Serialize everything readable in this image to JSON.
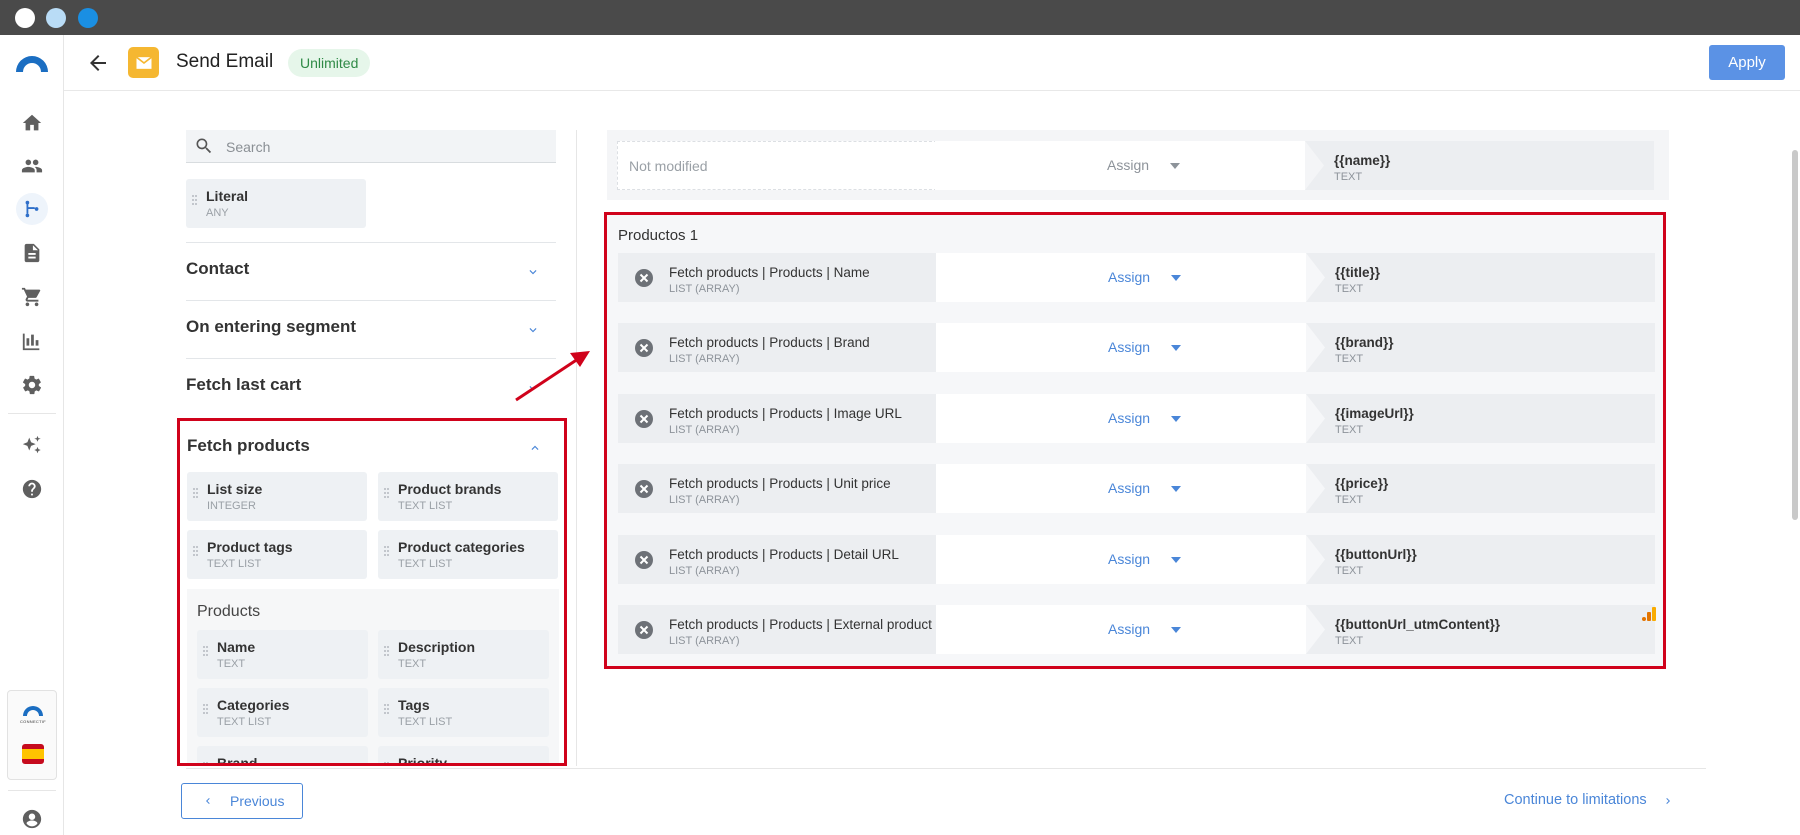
{
  "header": {
    "title": "Send Email",
    "plan_badge": "Unlimited",
    "apply_label": "Apply"
  },
  "rail": {
    "items": [
      "home-icon",
      "contacts-icon",
      "flows-icon",
      "document-icon",
      "cart-icon",
      "reports-icon",
      "settings-icon",
      "ai-sparkle-icon",
      "help-icon"
    ],
    "active": "flows-icon",
    "brand_text": "CONNECTIF",
    "language": "es"
  },
  "left_panel": {
    "search_placeholder": "Search",
    "literal": {
      "label": "Literal",
      "type": "ANY"
    },
    "sections": [
      {
        "title": "Contact",
        "expanded": false
      },
      {
        "title": "On entering segment",
        "expanded": false
      },
      {
        "title": "Fetch last cart",
        "expanded": false
      },
      {
        "title": "Fetch products",
        "expanded": true
      }
    ],
    "fetch_products_fields": [
      {
        "label": "List size",
        "type": "INTEGER"
      },
      {
        "label": "Product brands",
        "type": "TEXT LIST"
      },
      {
        "label": "Product tags",
        "type": "TEXT LIST"
      },
      {
        "label": "Product categories",
        "type": "TEXT LIST"
      }
    ],
    "products_group": {
      "title": "Products",
      "fields": [
        {
          "label": "Name",
          "type": "TEXT"
        },
        {
          "label": "Description",
          "type": "TEXT"
        },
        {
          "label": "Categories",
          "type": "TEXT LIST"
        },
        {
          "label": "Tags",
          "type": "TEXT LIST"
        },
        {
          "label": "Brand",
          "type": ""
        },
        {
          "label": "Priority",
          "type": ""
        }
      ]
    }
  },
  "mapping": {
    "top_row": {
      "source": "Not modified",
      "action": "Assign",
      "target": "{{name}}",
      "target_type": "TEXT"
    },
    "group_title": "Productos 1",
    "rows": [
      {
        "source": "Fetch products | Products | Name",
        "source_type": "LIST (ARRAY)",
        "action": "Assign",
        "target": "{{title}}",
        "target_type": "TEXT"
      },
      {
        "source": "Fetch products | Products | Brand",
        "source_type": "LIST (ARRAY)",
        "action": "Assign",
        "target": "{{brand}}",
        "target_type": "TEXT"
      },
      {
        "source": "Fetch products | Products | Image URL",
        "source_type": "LIST (ARRAY)",
        "action": "Assign",
        "target": "{{imageUrl}}",
        "target_type": "TEXT"
      },
      {
        "source": "Fetch products | Products | Unit price",
        "source_type": "LIST (ARRAY)",
        "action": "Assign",
        "target": "{{price}}",
        "target_type": "TEXT"
      },
      {
        "source": "Fetch products | Products | Detail URL",
        "source_type": "LIST (ARRAY)",
        "action": "Assign",
        "target": "{{buttonUrl}}",
        "target_type": "TEXT"
      },
      {
        "source": "Fetch products | Products | External product ID",
        "source_type": "LIST (ARRAY)",
        "action": "Assign",
        "target": "{{buttonUrl_utmContent}}",
        "target_type": "TEXT"
      }
    ]
  },
  "footer": {
    "previous_label": "Previous",
    "next_label": "Continue to limitations"
  },
  "colors": {
    "accent": "#4a86d8",
    "apply_button": "#5b92e5",
    "highlight_border": "#d0021b",
    "badge_bg": "#e6f6ea",
    "badge_text": "#2f8a46",
    "mail_icon_bg": "#f5b731"
  }
}
